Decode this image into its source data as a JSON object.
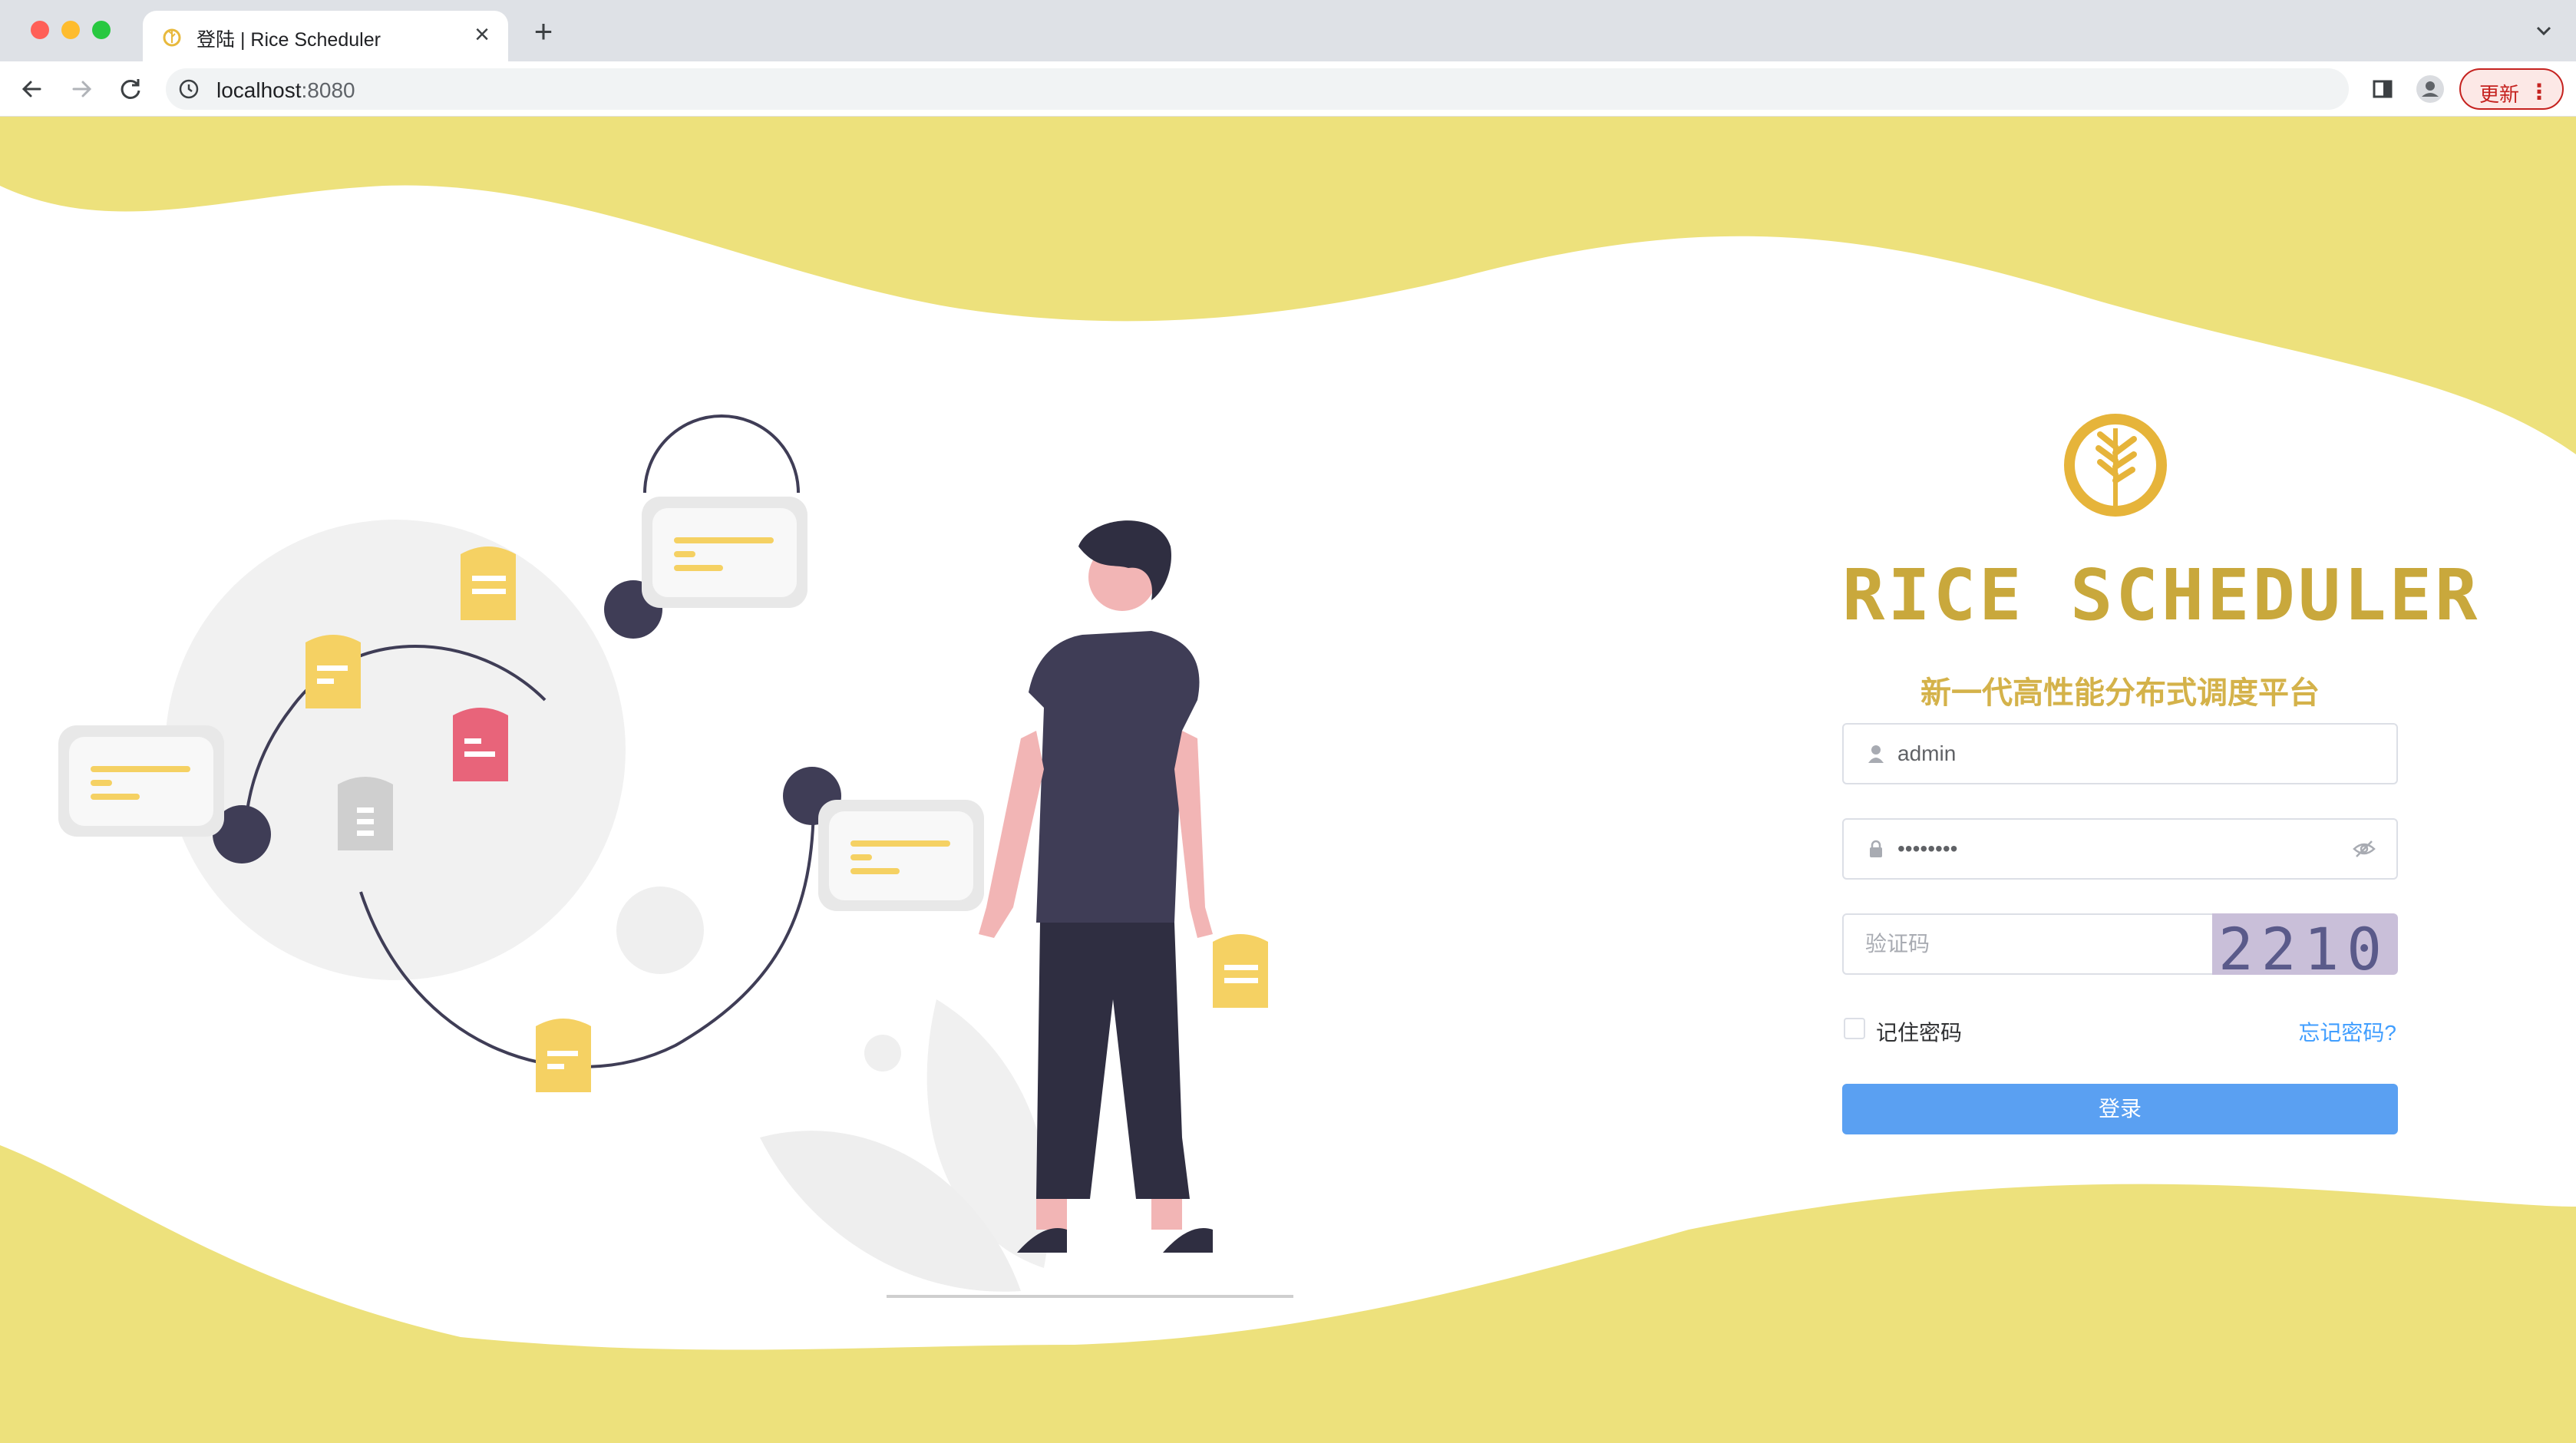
{
  "browser": {
    "tab_title": "登陆 | Rice Scheduler",
    "address_host": "localhost",
    "address_port": ":8080",
    "update_label": "更新",
    "icons": [
      "back-icon",
      "forward-icon",
      "reload-icon",
      "info-icon",
      "side-panel-icon",
      "profile-icon",
      "kebab-menu-icon",
      "tab-close-icon",
      "new-tab-icon",
      "tab-search-icon"
    ]
  },
  "login": {
    "brand": "RICE SCHEDULER",
    "slogan": "新一代高性能分布式调度平台",
    "username_value": "admin",
    "password_value": "••••••••",
    "captcha_placeholder": "验证码",
    "captcha_code": "2210",
    "remember_label": "记住密码",
    "forgot_label": "忘记密码?",
    "submit_label": "登录"
  },
  "colors": {
    "wave": "#ede17c",
    "brand": "#c9a83c",
    "button": "#5aa0f2",
    "link": "#409eff"
  }
}
